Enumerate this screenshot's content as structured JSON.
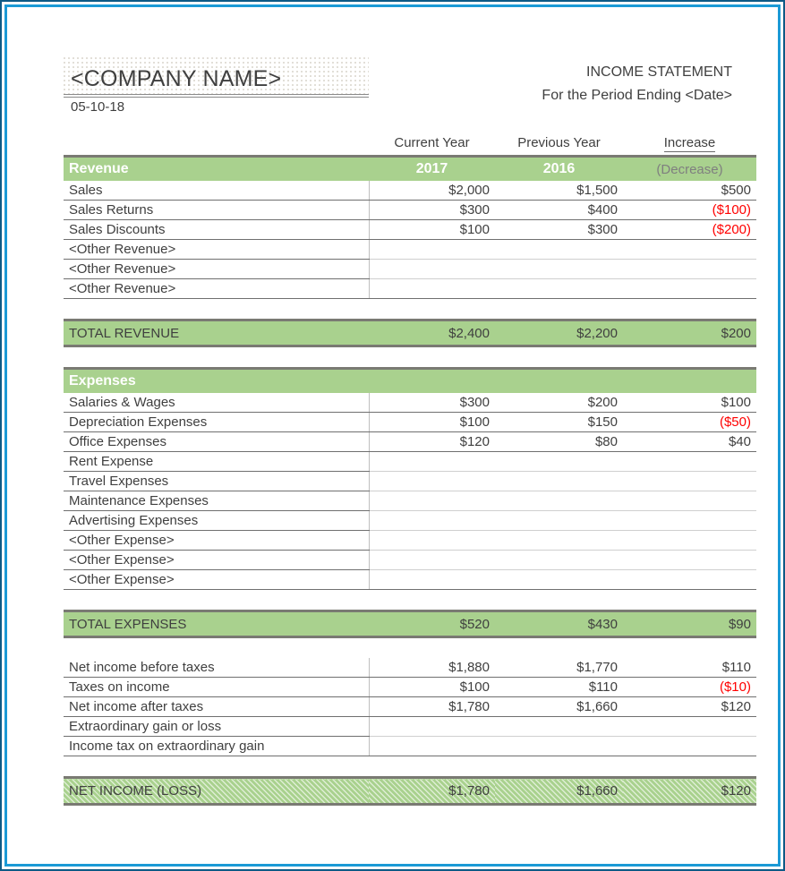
{
  "frame": {
    "outer_border_color": "#0e5a86",
    "inner_border_color": "#1b9ad6"
  },
  "theme": {
    "green": "#a9d18e",
    "border_gray": "#7a7a73",
    "text": "#3f3f3f",
    "negative": "#ff0000"
  },
  "header": {
    "company_name": "<COMPANY NAME>",
    "date": "05-10-18",
    "statement_title": "INCOME STATEMENT",
    "period_line": "For the Period Ending <Date>"
  },
  "columns": {
    "current_year_header": "Current Year",
    "previous_year_header": "Previous Year",
    "increase_header": "Increase",
    "decrease_header": "(Decrease)",
    "current_year": "2017",
    "previous_year": "2016"
  },
  "sections": {
    "revenue": {
      "title": "Revenue",
      "rows": [
        {
          "label": "Sales",
          "current": "$2,000",
          "previous": "$1,500",
          "change": "$500",
          "change_negative": false
        },
        {
          "label": "Sales Returns",
          "current": "$300",
          "previous": "$400",
          "change": "($100)",
          "change_negative": true
        },
        {
          "label": "Sales Discounts",
          "current": "$100",
          "previous": "$300",
          "change": "($200)",
          "change_negative": true
        },
        {
          "label": "<Other Revenue>",
          "current": "",
          "previous": "",
          "change": "",
          "change_negative": false
        },
        {
          "label": "<Other Revenue>",
          "current": "",
          "previous": "",
          "change": "",
          "change_negative": false
        },
        {
          "label": "<Other Revenue>",
          "current": "",
          "previous": "",
          "change": "",
          "change_negative": false
        }
      ],
      "total": {
        "label": "TOTAL REVENUE",
        "current": "$2,400",
        "previous": "$2,200",
        "change": "$200",
        "change_negative": false
      }
    },
    "expenses": {
      "title": "Expenses",
      "rows": [
        {
          "label": "Salaries & Wages",
          "current": "$300",
          "previous": "$200",
          "change": "$100",
          "change_negative": false
        },
        {
          "label": "Depreciation Expenses",
          "current": "$100",
          "previous": "$150",
          "change": "($50)",
          "change_negative": true
        },
        {
          "label": "Office Expenses",
          "current": "$120",
          "previous": "$80",
          "change": "$40",
          "change_negative": false
        },
        {
          "label": "Rent Expense",
          "current": "",
          "previous": "",
          "change": "",
          "change_negative": false
        },
        {
          "label": "Travel Expenses",
          "current": "",
          "previous": "",
          "change": "",
          "change_negative": false
        },
        {
          "label": "Maintenance Expenses",
          "current": "",
          "previous": "",
          "change": "",
          "change_negative": false
        },
        {
          "label": "Advertising Expenses",
          "current": "",
          "previous": "",
          "change": "",
          "change_negative": false
        },
        {
          "label": "<Other Expense>",
          "current": "",
          "previous": "",
          "change": "",
          "change_negative": false
        },
        {
          "label": "<Other Expense>",
          "current": "",
          "previous": "",
          "change": "",
          "change_negative": false
        },
        {
          "label": "<Other Expense>",
          "current": "",
          "previous": "",
          "change": "",
          "change_negative": false
        }
      ],
      "total": {
        "label": "TOTAL EXPENSES",
        "current": "$520",
        "previous": "$430",
        "change": "$90",
        "change_negative": false
      }
    },
    "net": {
      "rows": [
        {
          "label": "Net income before taxes",
          "current": "$1,880",
          "previous": "$1,770",
          "change": "$110",
          "change_negative": false
        },
        {
          "label": "Taxes on income",
          "current": "$100",
          "previous": "$110",
          "change": "($10)",
          "change_negative": true
        },
        {
          "label": "Net income after taxes",
          "current": "$1,780",
          "previous": "$1,660",
          "change": "$120",
          "change_negative": false
        },
        {
          "label": "Extraordinary gain or loss",
          "current": "",
          "previous": "",
          "change": "",
          "change_negative": false
        },
        {
          "label": "Income tax on extraordinary gain",
          "current": "",
          "previous": "",
          "change": "",
          "change_negative": false
        }
      ],
      "grand_total": {
        "label": "NET INCOME (LOSS)",
        "current": "$1,780",
        "previous": "$1,660",
        "change": "$120",
        "change_negative": false
      }
    }
  }
}
